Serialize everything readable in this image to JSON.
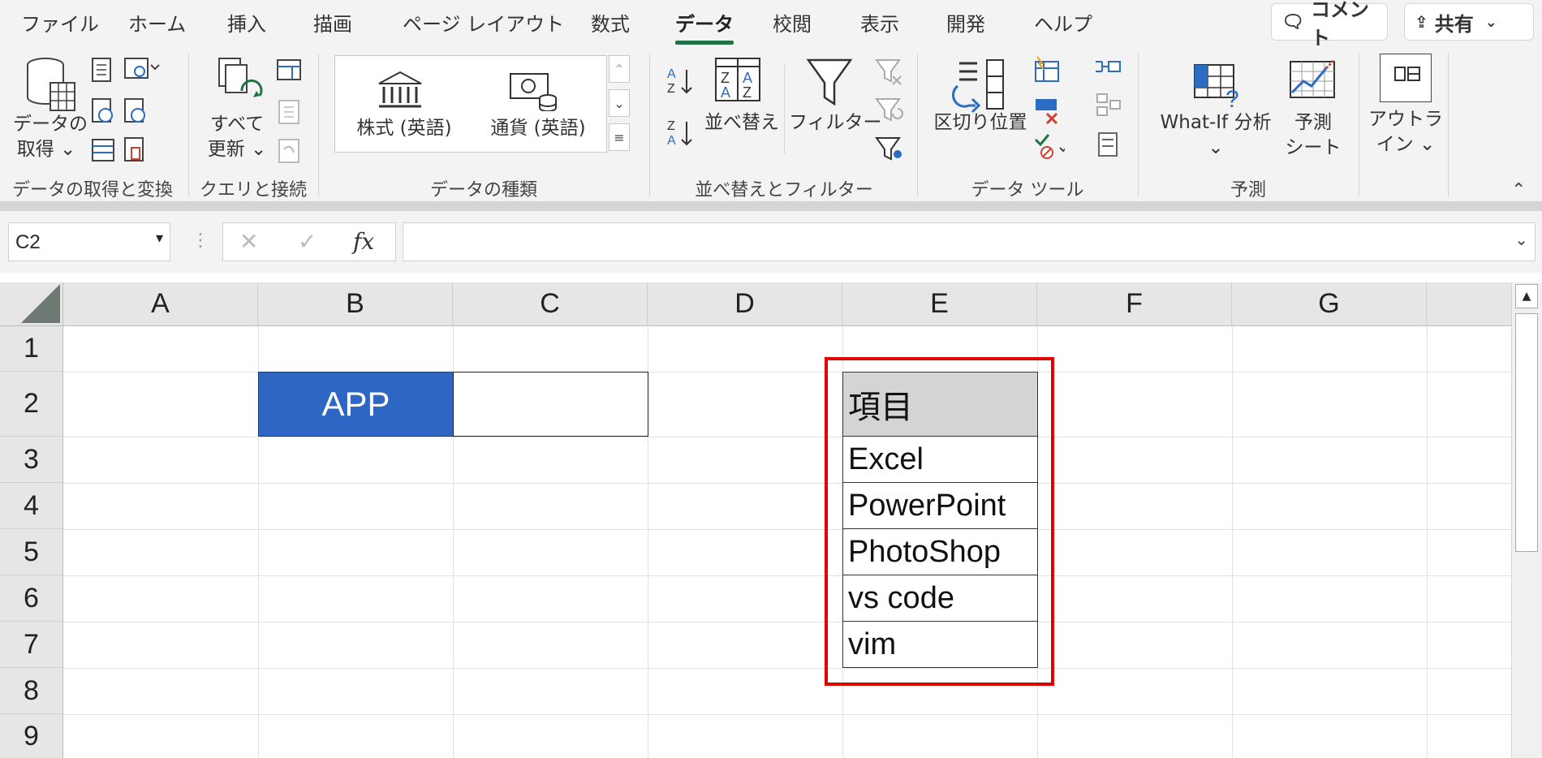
{
  "menu_tabs": [
    "ファイル",
    "ホーム",
    "挿入",
    "描画",
    "ページ レイアウト",
    "数式",
    "データ",
    "校閲",
    "表示",
    "開発",
    "ヘルプ"
  ],
  "active_tab": "データ",
  "top_buttons": {
    "comment": "コメント",
    "share": "共有"
  },
  "ribbon": {
    "get_data": {
      "line1": "データの",
      "line2": "取得 ⌄"
    },
    "refresh_all": {
      "line1": "すべて",
      "line2": "更新 ⌄"
    },
    "stocks": "株式 (英語)",
    "currencies": "通貨 (英語)",
    "sort": "並べ替え",
    "filter": "フィルター",
    "text_to_columns": "区切り位置",
    "what_if": {
      "line1": "What-If 分析",
      "line2": "⌄"
    },
    "forecast_sheet": {
      "line1": "予測",
      "line2": "シート"
    },
    "outline": {
      "line1": "アウトラ",
      "line2": "イン ⌄"
    },
    "groups": {
      "get_transform": "データの取得と変換",
      "queries": "クエリと接続",
      "data_types": "データの種類",
      "sort_filter": "並べ替えとフィルター",
      "data_tools": "データ ツール",
      "forecast": "予測"
    }
  },
  "formula_bar": {
    "name_box": "C2",
    "fx_label": "fx",
    "formula": ""
  },
  "grid": {
    "columns": [
      "A",
      "B",
      "C",
      "D",
      "E",
      "F",
      "G"
    ],
    "rows": [
      "1",
      "2",
      "3",
      "4",
      "5",
      "6",
      "7",
      "8",
      "9"
    ]
  },
  "cells": {
    "B2": "APP",
    "C2": "",
    "E2": "項目",
    "E3": "Excel",
    "E4": "PowerPoint",
    "E5": "PhotoShop",
    "E6": "vs code",
    "E7": "vim"
  },
  "colors": {
    "app_fill": "#2e67c3",
    "highlight": "#e00000",
    "header_fill": "#d4d4d4",
    "accent": "#217346"
  }
}
